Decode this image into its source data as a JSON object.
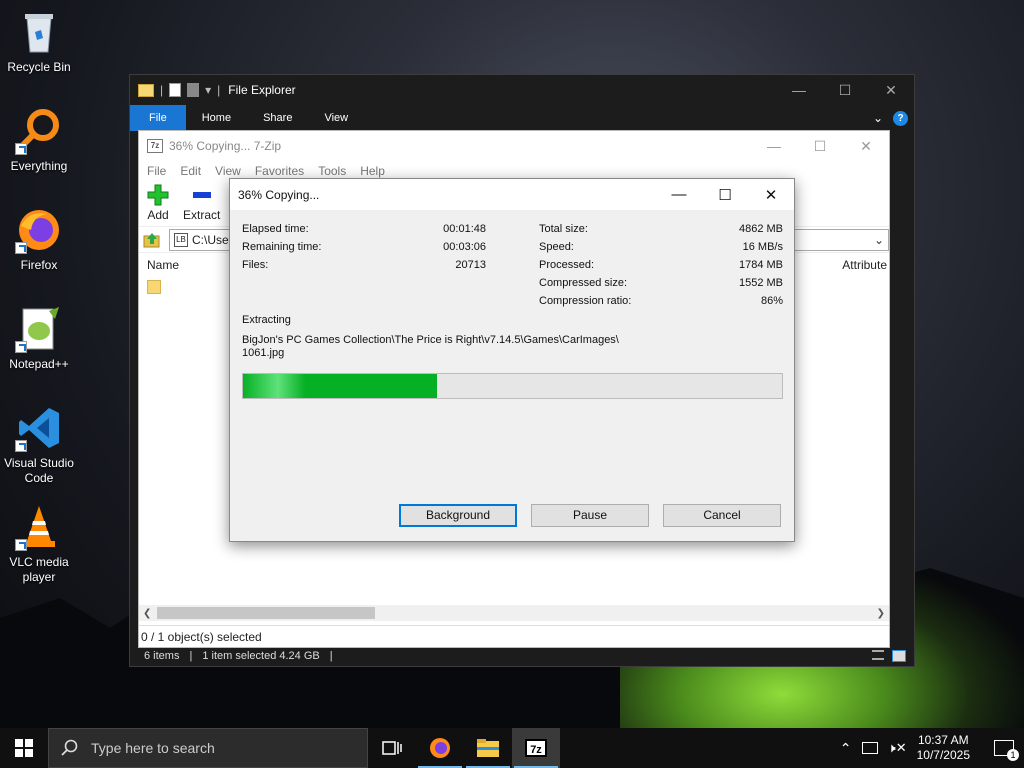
{
  "desktop": {
    "icons": [
      {
        "label": "Recycle Bin"
      },
      {
        "label": "Everything"
      },
      {
        "label": "Firefox"
      },
      {
        "label": "Notepad++"
      },
      {
        "label": "Visual Studio Code"
      },
      {
        "label": "VLC media player"
      }
    ]
  },
  "explorer": {
    "title": "File Explorer",
    "ribbon_tabs": [
      "File",
      "Home",
      "Share",
      "View"
    ],
    "status": {
      "items": "6 items",
      "selected": "1 item selected  4.24 GB"
    }
  },
  "sevenzip": {
    "title": "36% Copying... 7-Zip",
    "menu": [
      "File",
      "Edit",
      "View",
      "Favorites",
      "Tools",
      "Help"
    ],
    "toolbar": {
      "add": "Add",
      "extract": "Extract"
    },
    "address": "C:\\Use",
    "columns": {
      "name": "Name",
      "attributes": "Attribute"
    },
    "status": "0 / 1 object(s) selected"
  },
  "dialog": {
    "title": "36% Copying...",
    "left_stats": [
      {
        "label": "Elapsed time:",
        "value": "00:01:48"
      },
      {
        "label": "Remaining time:",
        "value": "00:03:06"
      },
      {
        "label": "Files:",
        "value": "20713"
      }
    ],
    "right_stats": [
      {
        "label": "Total size:",
        "value": "4862 MB"
      },
      {
        "label": "Speed:",
        "value": "16 MB/s"
      },
      {
        "label": "Processed:",
        "value": "1784 MB"
      },
      {
        "label": "Compressed size:",
        "value": "1552 MB"
      },
      {
        "label": "Compression ratio:",
        "value": "86%"
      }
    ],
    "action": "Extracting",
    "path_line1": "BigJon's PC Games Collection\\The Price is Right\\v7.14.5\\Games\\CarImages\\",
    "path_line2": "1061.jpg",
    "progress": 0.36,
    "buttons": {
      "background": "Background",
      "pause": "Pause",
      "cancel": "Cancel"
    }
  },
  "taskbar": {
    "search_placeholder": "Type here to search",
    "time": "10:37 AM",
    "date": "10/7/2025",
    "notification_count": "1"
  },
  "colors": {
    "progress": "#06b025",
    "accent": "#1976d2",
    "taskbar": "#101010"
  }
}
